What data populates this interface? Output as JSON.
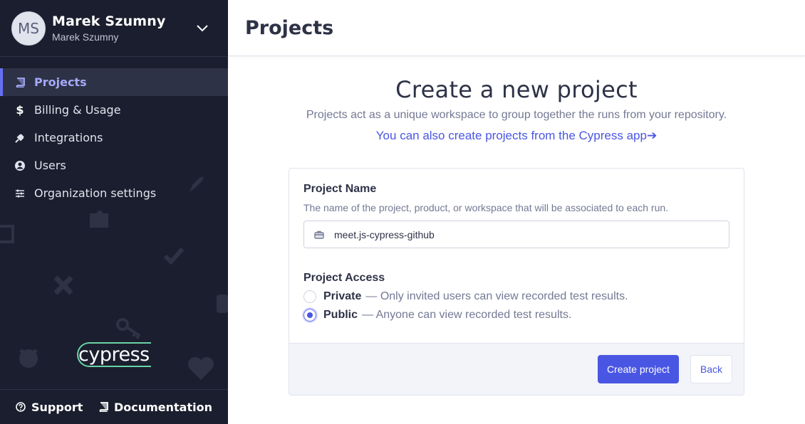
{
  "user": {
    "initials": "MS",
    "name": "Marek Szumny",
    "org": "Marek Szumny"
  },
  "sidebar": {
    "items": [
      {
        "label": "Projects",
        "icon": "book-icon",
        "active": true
      },
      {
        "label": "Billing & Usage",
        "icon": "dollar-icon"
      },
      {
        "label": "Integrations",
        "icon": "plug-icon"
      },
      {
        "label": "Users",
        "icon": "user-icon"
      },
      {
        "label": "Organization settings",
        "icon": "sliders-icon"
      }
    ],
    "logo_text": "cypress",
    "footer": {
      "support": "Support",
      "documentation": "Documentation"
    }
  },
  "header": {
    "title": "Projects"
  },
  "hero": {
    "title": "Create a new project",
    "subtitle": "Projects act as a unique workspace to group together the runs from your repository.",
    "link": "You can also create projects from the Cypress app➔"
  },
  "form": {
    "name_label": "Project Name",
    "name_hint": "The name of the project, product, or workspace that will be associated to each run.",
    "name_value": "meet.js-cypress-github",
    "access_label": "Project Access",
    "private_label": "Private",
    "private_desc": "— Only invited users can view recorded test results.",
    "public_label": "Public",
    "public_desc": "— Anyone can view recorded test results.",
    "selected_access": "Public",
    "create_button": "Create project",
    "back_button": "Back"
  },
  "colors": {
    "accent": "#4956e3",
    "sidebar_bg": "#1b1e2e",
    "active_text": "#a3aaf7"
  }
}
